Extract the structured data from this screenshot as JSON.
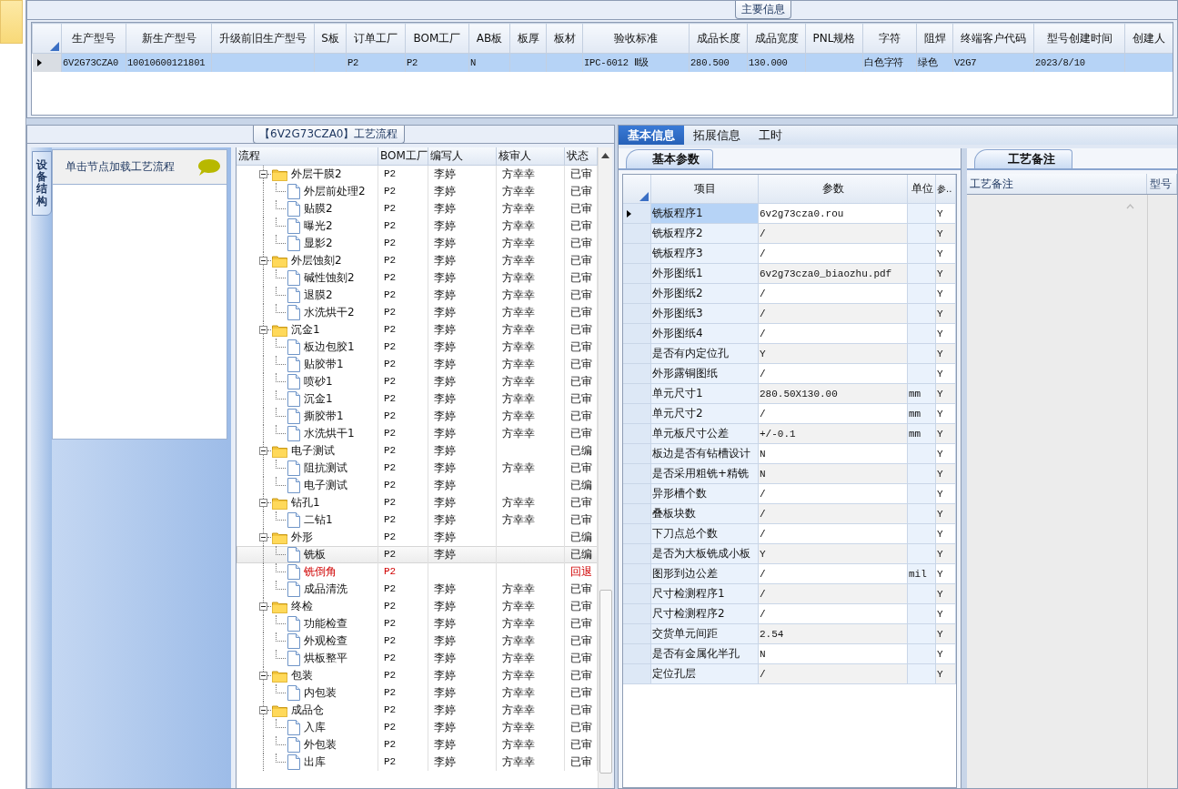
{
  "main_info": {
    "title": "主要信息",
    "columns": [
      "生产型号",
      "新生产型号",
      "升级前旧生产型号",
      "S板",
      "订单工厂",
      "BOM工厂",
      "AB板",
      "板厚",
      "板材",
      "验收标准",
      "成品长度",
      "成品宽度",
      "PNL规格",
      "字符",
      "阻焊",
      "终端客户代码",
      "型号创建时间",
      "创建人"
    ],
    "rows": [
      {
        "selected": true,
        "cells": [
          "6V2G73CZA0",
          "10010600121801",
          null,
          null,
          "P2",
          "P2",
          "N",
          null,
          null,
          "IPC-6012 Ⅱ级",
          "280.500",
          "130.000",
          null,
          "白色字符",
          "绿色",
          "V2G7",
          "2023/8/10",
          null
        ]
      }
    ]
  },
  "process": {
    "title": "【6V2G73CZA0】工艺流程",
    "side_tab": "设备结构",
    "hint": "单击节点加载工艺流程",
    "columns": [
      "流程",
      "BOM工厂",
      "编写人",
      "核审人",
      "状态"
    ],
    "tree": [
      {
        "name": "外层干膜2",
        "factory": "P2",
        "writer": "李婷",
        "reviewer": "方幸幸",
        "status": "已审",
        "expanded": true,
        "selected": false,
        "returned": false,
        "children": [
          {
            "name": "外层前处理2",
            "factory": "P2",
            "writer": "李婷",
            "reviewer": "方幸幸",
            "status": "已审",
            "selected": false,
            "returned": false
          },
          {
            "name": "贴膜2",
            "factory": "P2",
            "writer": "李婷",
            "reviewer": "方幸幸",
            "status": "已审",
            "selected": false,
            "returned": false
          },
          {
            "name": "曝光2",
            "factory": "P2",
            "writer": "李婷",
            "reviewer": "方幸幸",
            "status": "已审",
            "selected": false,
            "returned": false
          },
          {
            "name": "显影2",
            "factory": "P2",
            "writer": "李婷",
            "reviewer": "方幸幸",
            "status": "已审",
            "selected": false,
            "returned": false
          }
        ]
      },
      {
        "name": "外层蚀刻2",
        "factory": "P2",
        "writer": "李婷",
        "reviewer": "方幸幸",
        "status": "已审",
        "expanded": true,
        "selected": false,
        "returned": false,
        "children": [
          {
            "name": "碱性蚀刻2",
            "factory": "P2",
            "writer": "李婷",
            "reviewer": "方幸幸",
            "status": "已审",
            "selected": false,
            "returned": false
          },
          {
            "name": "退膜2",
            "factory": "P2",
            "writer": "李婷",
            "reviewer": "方幸幸",
            "status": "已审",
            "selected": false,
            "returned": false
          },
          {
            "name": "水洗烘干2",
            "factory": "P2",
            "writer": "李婷",
            "reviewer": "方幸幸",
            "status": "已审",
            "selected": false,
            "returned": false
          }
        ]
      },
      {
        "name": "沉金1",
        "factory": "P2",
        "writer": "李婷",
        "reviewer": "方幸幸",
        "status": "已审",
        "expanded": true,
        "selected": false,
        "returned": false,
        "children": [
          {
            "name": "板边包胶1",
            "factory": "P2",
            "writer": "李婷",
            "reviewer": "方幸幸",
            "status": "已审",
            "selected": false,
            "returned": false
          },
          {
            "name": "贴胶带1",
            "factory": "P2",
            "writer": "李婷",
            "reviewer": "方幸幸",
            "status": "已审",
            "selected": false,
            "returned": false
          },
          {
            "name": "喷砂1",
            "factory": "P2",
            "writer": "李婷",
            "reviewer": "方幸幸",
            "status": "已审",
            "selected": false,
            "returned": false
          },
          {
            "name": "沉金1",
            "factory": "P2",
            "writer": "李婷",
            "reviewer": "方幸幸",
            "status": "已审",
            "selected": false,
            "returned": false
          },
          {
            "name": "撕胶带1",
            "factory": "P2",
            "writer": "李婷",
            "reviewer": "方幸幸",
            "status": "已审",
            "selected": false,
            "returned": false
          },
          {
            "name": "水洗烘干1",
            "factory": "P2",
            "writer": "李婷",
            "reviewer": "方幸幸",
            "status": "已审",
            "selected": false,
            "returned": false
          }
        ]
      },
      {
        "name": "电子测试",
        "factory": "P2",
        "writer": "李婷",
        "status": "已编",
        "expanded": true,
        "selected": false,
        "returned": false,
        "children": [
          {
            "name": "阻抗测试",
            "factory": "P2",
            "writer": "李婷",
            "reviewer": "方幸幸",
            "status": "已审",
            "selected": false,
            "returned": false
          },
          {
            "name": "电子测试",
            "factory": "P2",
            "writer": "李婷",
            "status": "已编",
            "selected": false,
            "returned": false
          }
        ]
      },
      {
        "name": "钻孔1",
        "factory": "P2",
        "writer": "李婷",
        "reviewer": "方幸幸",
        "status": "已审",
        "expanded": true,
        "selected": false,
        "returned": false,
        "children": [
          {
            "name": "二钻1",
            "factory": "P2",
            "writer": "李婷",
            "reviewer": "方幸幸",
            "status": "已审",
            "selected": false,
            "returned": false
          }
        ]
      },
      {
        "name": "外形",
        "factory": "P2",
        "writer": "李婷",
        "status": "已编",
        "expanded": true,
        "selected": false,
        "returned": false,
        "children": [
          {
            "name": "铣板",
            "factory": "P2",
            "writer": "李婷",
            "status": "已编",
            "selected": true,
            "returned": false
          },
          {
            "name": "铣倒角",
            "factory": "P2",
            "status": "回退",
            "selected": false,
            "returned": true
          },
          {
            "name": "成品清洗",
            "factory": "P2",
            "writer": "李婷",
            "reviewer": "方幸幸",
            "status": "已审",
            "selected": false,
            "returned": false
          }
        ]
      },
      {
        "name": "终检",
        "factory": "P2",
        "writer": "李婷",
        "reviewer": "方幸幸",
        "status": "已审",
        "expanded": true,
        "selected": false,
        "returned": false,
        "children": [
          {
            "name": "功能检查",
            "factory": "P2",
            "writer": "李婷",
            "reviewer": "方幸幸",
            "status": "已审",
            "selected": false,
            "returned": false
          },
          {
            "name": "外观检查",
            "factory": "P2",
            "writer": "李婷",
            "reviewer": "方幸幸",
            "status": "已审",
            "selected": false,
            "returned": false
          },
          {
            "name": "烘板整平",
            "factory": "P2",
            "writer": "李婷",
            "reviewer": "方幸幸",
            "status": "已审",
            "selected": false,
            "returned": false
          }
        ]
      },
      {
        "name": "包装",
        "factory": "P2",
        "writer": "李婷",
        "reviewer": "方幸幸",
        "status": "已审",
        "expanded": true,
        "selected": false,
        "returned": false,
        "children": [
          {
            "name": "内包装",
            "factory": "P2",
            "writer": "李婷",
            "reviewer": "方幸幸",
            "status": "已审",
            "selected": false,
            "returned": false
          }
        ]
      },
      {
        "name": "成品仓",
        "factory": "P2",
        "writer": "李婷",
        "reviewer": "方幸幸",
        "status": "已审",
        "expanded": true,
        "selected": false,
        "returned": false,
        "children": [
          {
            "name": "入库",
            "factory": "P2",
            "writer": "李婷",
            "reviewer": "方幸幸",
            "status": "已审",
            "selected": false,
            "returned": false
          },
          {
            "name": "外包装",
            "factory": "P2",
            "writer": "李婷",
            "reviewer": "方幸幸",
            "status": "已审",
            "selected": false,
            "returned": false
          },
          {
            "name": "出库",
            "factory": "P2",
            "writer": "李婷",
            "reviewer": "方幸幸",
            "status": "已审",
            "selected": false,
            "returned": false
          }
        ]
      }
    ]
  },
  "detail": {
    "tabs": [
      {
        "label": "基本信息",
        "selected": true
      },
      {
        "label": "拓展信息",
        "selected": false
      },
      {
        "label": "工时",
        "selected": false
      }
    ],
    "params": {
      "tab": "基本参数",
      "columns": [
        "项目",
        "参数",
        "单位",
        "参.."
      ],
      "rows": [
        {
          "item": "铣板程序1",
          "value": "6v2g73cza0.rou",
          "flag": "Y",
          "selected": true
        },
        {
          "item": "铣板程序2",
          "value": "/",
          "flag": "Y",
          "selected": false
        },
        {
          "item": "铣板程序3",
          "value": "/",
          "flag": "Y",
          "selected": false
        },
        {
          "item": "外形图纸1",
          "value": "6v2g73cza0_biaozhu.pdf",
          "flag": "Y",
          "selected": false
        },
        {
          "item": "外形图纸2",
          "value": "/",
          "flag": "Y",
          "selected": false
        },
        {
          "item": "外形图纸3",
          "value": "/",
          "flag": "Y",
          "selected": false
        },
        {
          "item": "外形图纸4",
          "value": "/",
          "flag": "Y",
          "selected": false
        },
        {
          "item": "是否有内定位孔",
          "value": "Y",
          "flag": "Y",
          "selected": false
        },
        {
          "item": "外形露铜图纸",
          "value": "/",
          "flag": "Y",
          "selected": false
        },
        {
          "item": "单元尺寸1",
          "value": "280.50X130.00",
          "unit": "mm",
          "flag": "Y",
          "selected": false
        },
        {
          "item": "单元尺寸2",
          "value": "/",
          "unit": "mm",
          "flag": "Y",
          "selected": false
        },
        {
          "item": "单元板尺寸公差",
          "value": "+/-0.1",
          "unit": "mm",
          "flag": "Y",
          "selected": false
        },
        {
          "item": "板边是否有钻槽设计",
          "value": "N",
          "flag": "Y",
          "selected": false
        },
        {
          "item": "是否采用粗铣+精铣",
          "value": "N",
          "flag": "Y",
          "selected": false
        },
        {
          "item": "异形槽个数",
          "value": "/",
          "flag": "Y",
          "selected": false
        },
        {
          "item": "叠板块数",
          "value": "/",
          "flag": "Y",
          "selected": false
        },
        {
          "item": "下刀点总个数",
          "value": "/",
          "flag": "Y",
          "selected": false
        },
        {
          "item": "是否为大板铣成小板",
          "value": "Y",
          "flag": "Y",
          "selected": false
        },
        {
          "item": "图形到边公差",
          "value": "/",
          "unit": "mil",
          "flag": "Y",
          "selected": false
        },
        {
          "item": "尺寸检测程序1",
          "value": "/",
          "flag": "Y",
          "selected": false
        },
        {
          "item": "尺寸检测程序2",
          "value": "/",
          "flag": "Y",
          "selected": false
        },
        {
          "item": "交货单元间距",
          "value": "2.54",
          "flag": "Y",
          "selected": false
        },
        {
          "item": "是否有金属化半孔",
          "value": "N",
          "flag": "Y",
          "selected": false
        },
        {
          "item": "定位孔层",
          "value": "/",
          "flag": "Y",
          "selected": false
        }
      ]
    },
    "notes": {
      "tab": "工艺备注",
      "columns": [
        "工艺备注",
        "型号"
      ]
    }
  }
}
